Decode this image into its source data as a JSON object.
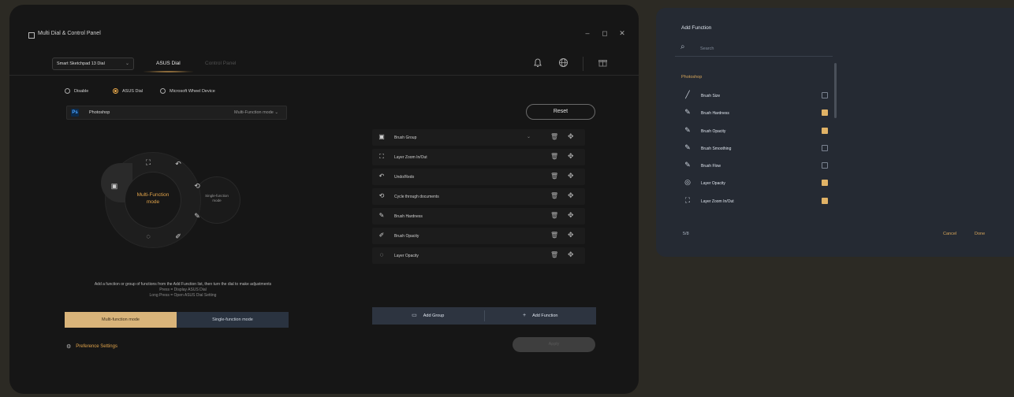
{
  "window": {
    "title": "Multi Dial & Control Panel",
    "controls": {
      "minimize": "‒",
      "maximize": "◻",
      "close": "✕"
    }
  },
  "header": {
    "device": "Smart Sketchpad 13 Dial",
    "tabs": [
      {
        "label": "ASUS Dial",
        "active": true
      },
      {
        "label": "Control Panel",
        "active": false
      }
    ],
    "icons": [
      "bell-icon",
      "globe-icon",
      "gift-icon"
    ]
  },
  "mode_radios": [
    {
      "label": "Disable",
      "selected": false
    },
    {
      "label": "ASUS Dial",
      "selected": true
    },
    {
      "label": "Microsoft Wheel Device",
      "selected": false
    }
  ],
  "app_bar": {
    "icon_text": "Ps",
    "app_name": "Photoshop",
    "mode_label": "Multi-Function mode"
  },
  "reset_label": "Reset",
  "dial": {
    "center_label_line1": "Multi-Function",
    "center_label_line2": "mode",
    "side_label_line1": "Single-function",
    "side_label_line2": "mode"
  },
  "hint": {
    "line1": "Add a function or group of functions from the Add Function list, then turn the dial to make adjustments",
    "line2": "Press = Display ASUS Dial",
    "line3": "Long Press = Open ASUS Dial Setting"
  },
  "mode_toggle": {
    "multi": "Multi-function mode",
    "single": "Single-function mode"
  },
  "preferences_label": "Preference Settings",
  "functions": [
    {
      "label": "Brush Group",
      "icon": "brush-group-icon",
      "expandable": true
    },
    {
      "label": "Layer Zoom In/Out",
      "icon": "zoom-icon",
      "expandable": false
    },
    {
      "label": "Undo/Redo",
      "icon": "undo-icon",
      "expandable": false
    },
    {
      "label": "Cycle through documents",
      "icon": "cycle-icon",
      "expandable": false
    },
    {
      "label": "Brush Hardness",
      "icon": "brush-icon",
      "expandable": false
    },
    {
      "label": "Brush Opacity",
      "icon": "brush-icon",
      "expandable": false
    },
    {
      "label": "Layer Opacity",
      "icon": "layer-icon",
      "expandable": false
    }
  ],
  "add_bar": {
    "group": "Add Group",
    "function": "Add Function"
  },
  "apply_label": "Apply",
  "panel": {
    "title": "Add Function",
    "search_placeholder": "Search",
    "group": "Photoshop",
    "items": [
      {
        "label": "Brush Size",
        "checked": false
      },
      {
        "label": "Brush Hardness",
        "checked": true
      },
      {
        "label": "Brush Opacity",
        "checked": true
      },
      {
        "label": "Brush Smoothing",
        "checked": false
      },
      {
        "label": "Brush Flow",
        "checked": false
      },
      {
        "label": "Layer Opacity",
        "checked": true
      },
      {
        "label": "Layer Zoom In/Out",
        "checked": true
      }
    ],
    "count": "5/8",
    "cancel": "Cancel",
    "confirm": "Done"
  },
  "colors": {
    "accent": "#e0a34a",
    "toggle_on": "#d9b47a",
    "panel_bg": "#252a33",
    "window_bg": "#161616"
  }
}
